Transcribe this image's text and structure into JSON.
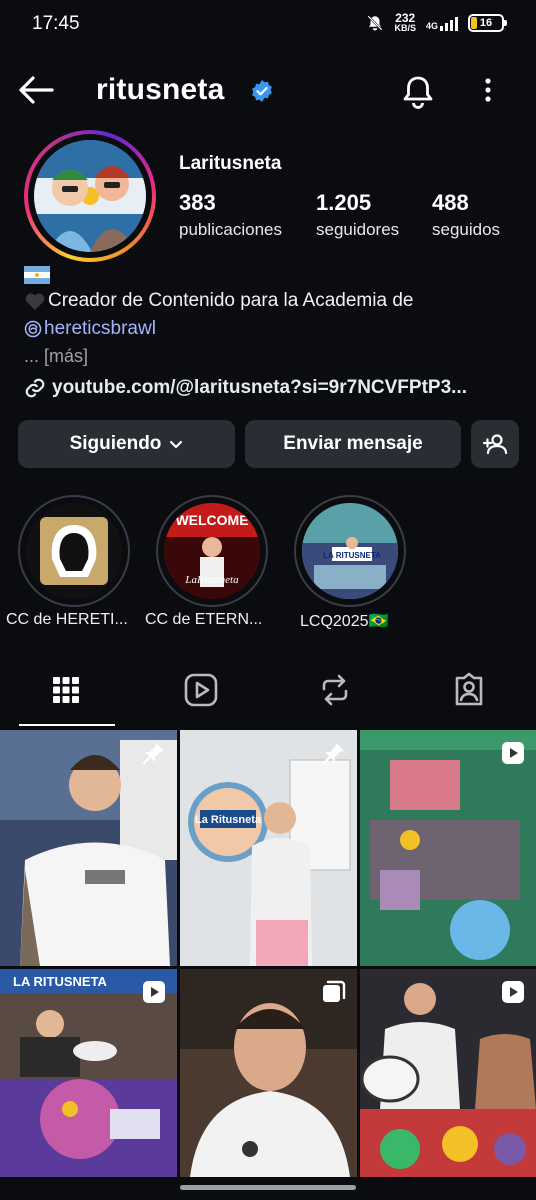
{
  "status_bar": {
    "time": "17:45",
    "net_speed_value": "232",
    "net_speed_unit": "KB/S",
    "network": "4G",
    "battery": "16",
    "icons": [
      "mute-icon",
      "signal-icon",
      "battery-icon"
    ]
  },
  "header": {
    "username": "ritusneta",
    "verified": true,
    "icons": [
      "back-arrow-icon",
      "verified-badge-icon",
      "bell-icon",
      "more-vertical-icon"
    ]
  },
  "profile": {
    "full_name": "Laritusneta",
    "stats": [
      {
        "value": "383",
        "label": "publicaciones"
      },
      {
        "value": "1.205",
        "label": "seguidores"
      },
      {
        "value": "488",
        "label": "seguidos"
      }
    ],
    "bio": {
      "flag": "argentina-flag-emoji",
      "line1": "Creador de Contenido para la Academia de",
      "line1_icon": "black-heart-emoji",
      "mention": "hereticsbrawl",
      "mention_icon": "threads-icon",
      "more": "... [más]",
      "link": "youtube.com/@laritusneta?si=9r7NCVFPtP3..."
    }
  },
  "actions": {
    "following": "Siguiendo",
    "message": "Enviar mensaje",
    "add_user_icon": "add-person-icon"
  },
  "highlights": [
    {
      "label": "CC de HERETI..."
    },
    {
      "label": "CC de ETERN..."
    },
    {
      "label": "LCQ2025🇧🇷"
    }
  ],
  "tabs": [
    {
      "name": "grid",
      "icon": "grid-icon",
      "active": true
    },
    {
      "name": "reels",
      "icon": "reels-icon",
      "active": false
    },
    {
      "name": "reposts",
      "icon": "repost-icon",
      "active": false
    },
    {
      "name": "tagged",
      "icon": "tagged-icon",
      "active": false
    }
  ],
  "grid_posts": [
    {
      "badge": "pin-icon",
      "desc": "man in white jersey pointing"
    },
    {
      "badge": "pin-icon",
      "desc": "man with La Ritusneta logo"
    },
    {
      "badge": "reel-icon",
      "desc": "Brawl Stars gameplay"
    },
    {
      "badge": "reel-icon",
      "desc": "La Ritusneta banner stream"
    },
    {
      "badge": "carousel-icon",
      "desc": "selfie man in white jersey"
    },
    {
      "badge": "reel-icon",
      "desc": "man with drum"
    }
  ],
  "colors": {
    "background": "#0b0c10",
    "button": "#2b2d34",
    "mention": "#a5b4fc",
    "verified": "#3897f0"
  }
}
